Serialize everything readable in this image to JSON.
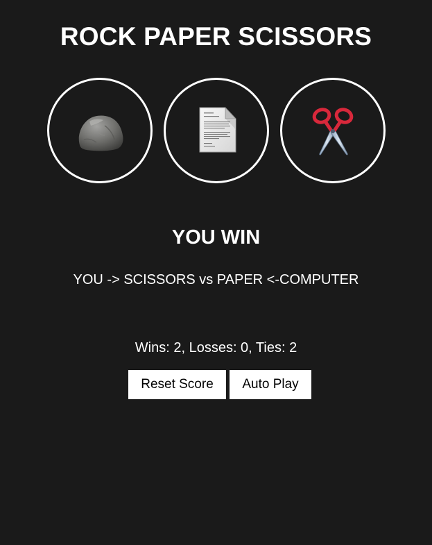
{
  "title": "ROCK PAPER SCISSORS",
  "choices": [
    {
      "name": "rock",
      "icon": "rock-icon"
    },
    {
      "name": "paper",
      "icon": "paper-document-icon"
    },
    {
      "name": "scissors",
      "icon": "scissors-icon"
    }
  ],
  "result": "YOU WIN",
  "moves_text": "YOU -> SCISSORS vs PAPER <-COMPUTER",
  "score_text": "Wins: 2, Losses: 0, Ties: 2",
  "buttons": {
    "reset_label": "Reset Score",
    "auto_play_label": "Auto Play"
  },
  "colors": {
    "background": "#1a1a1a",
    "text": "#ffffff",
    "button_bg": "#ffffff",
    "button_text": "#000000"
  }
}
